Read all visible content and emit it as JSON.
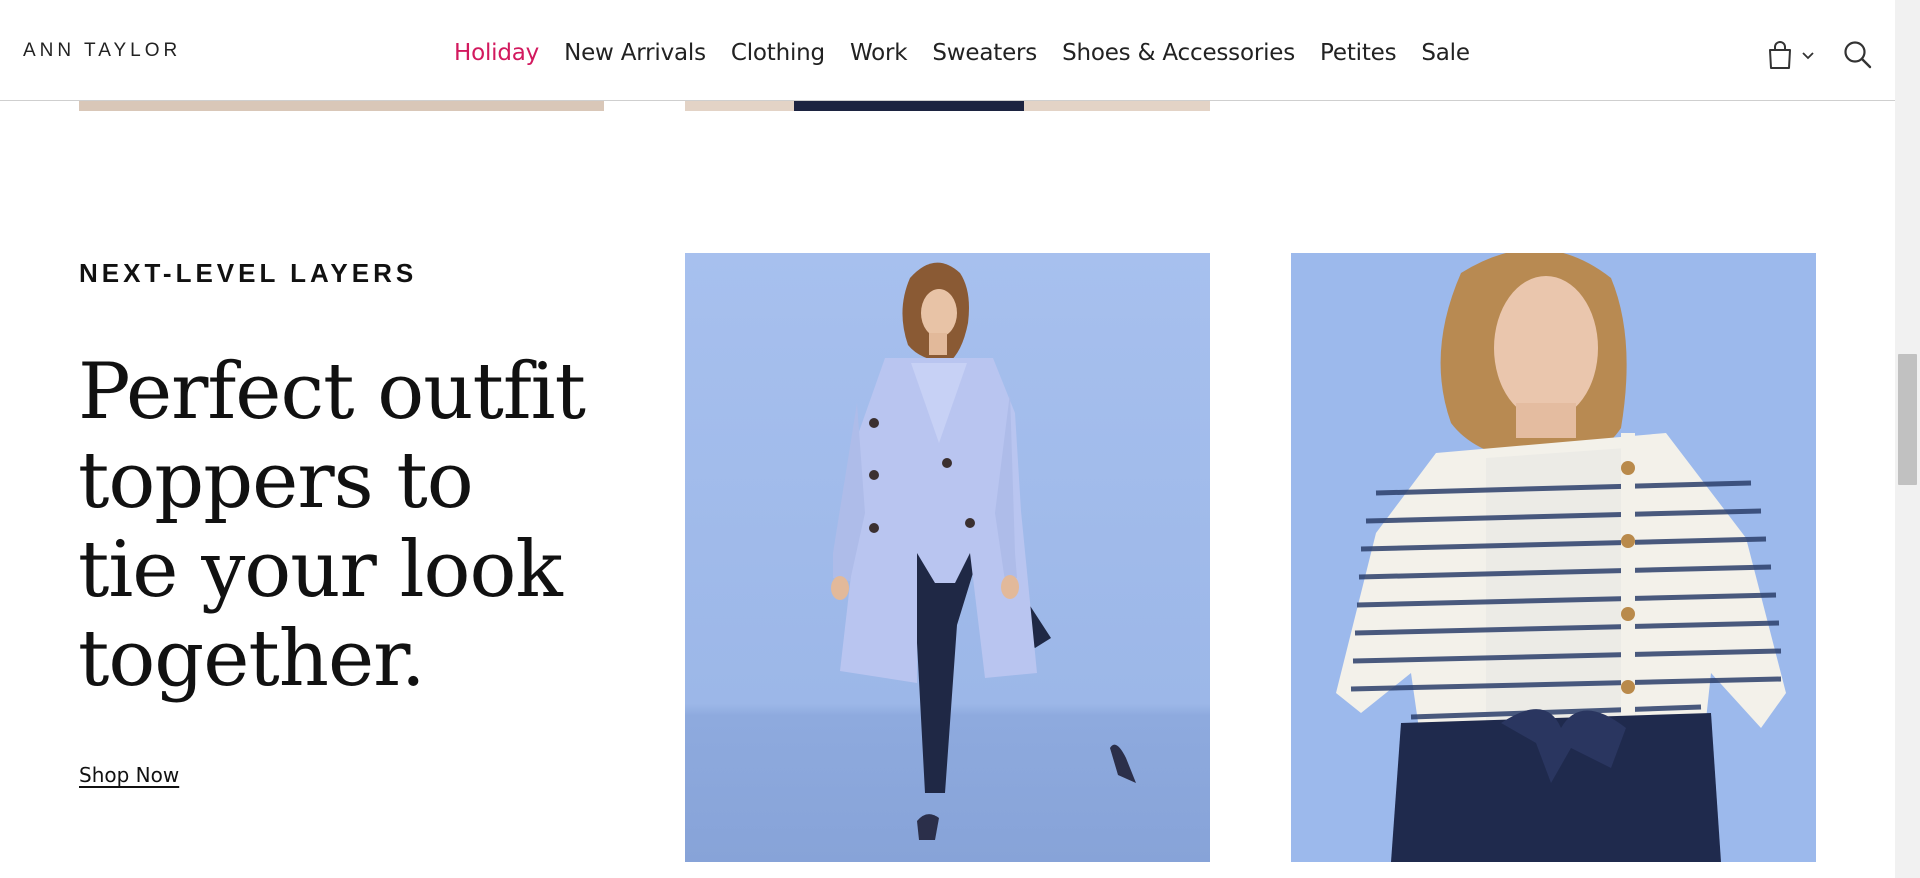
{
  "brand": {
    "logo_text": "ANN TAYLOR"
  },
  "nav": {
    "items": [
      {
        "label": "Holiday",
        "active": true
      },
      {
        "label": "New Arrivals",
        "active": false
      },
      {
        "label": "Clothing",
        "active": false
      },
      {
        "label": "Work",
        "active": false
      },
      {
        "label": "Sweaters",
        "active": false
      },
      {
        "label": "Shoes & Accessories",
        "active": false
      },
      {
        "label": "Petites",
        "active": false
      },
      {
        "label": "Sale",
        "active": false
      }
    ]
  },
  "header_icons": {
    "cart": "shopping-bag-icon",
    "cart_menu": "chevron-down-icon",
    "search": "search-icon"
  },
  "section": {
    "eyebrow": "NEXT-LEVEL LAYERS",
    "headline_lines": [
      "Perfect outfit",
      "toppers to",
      "tie your look",
      "together."
    ],
    "cta": "Shop Now"
  },
  "images": [
    {
      "name": "trench-coat-model-photo",
      "subject": "model in lavender trench coat and navy pants"
    },
    {
      "name": "striped-cardigan-model-photo",
      "subject": "model in striped cardigan with navy bottoms"
    }
  ],
  "colors": {
    "accent": "#d2195e",
    "text": "#111111",
    "photo_bg": "#9db8e8"
  }
}
